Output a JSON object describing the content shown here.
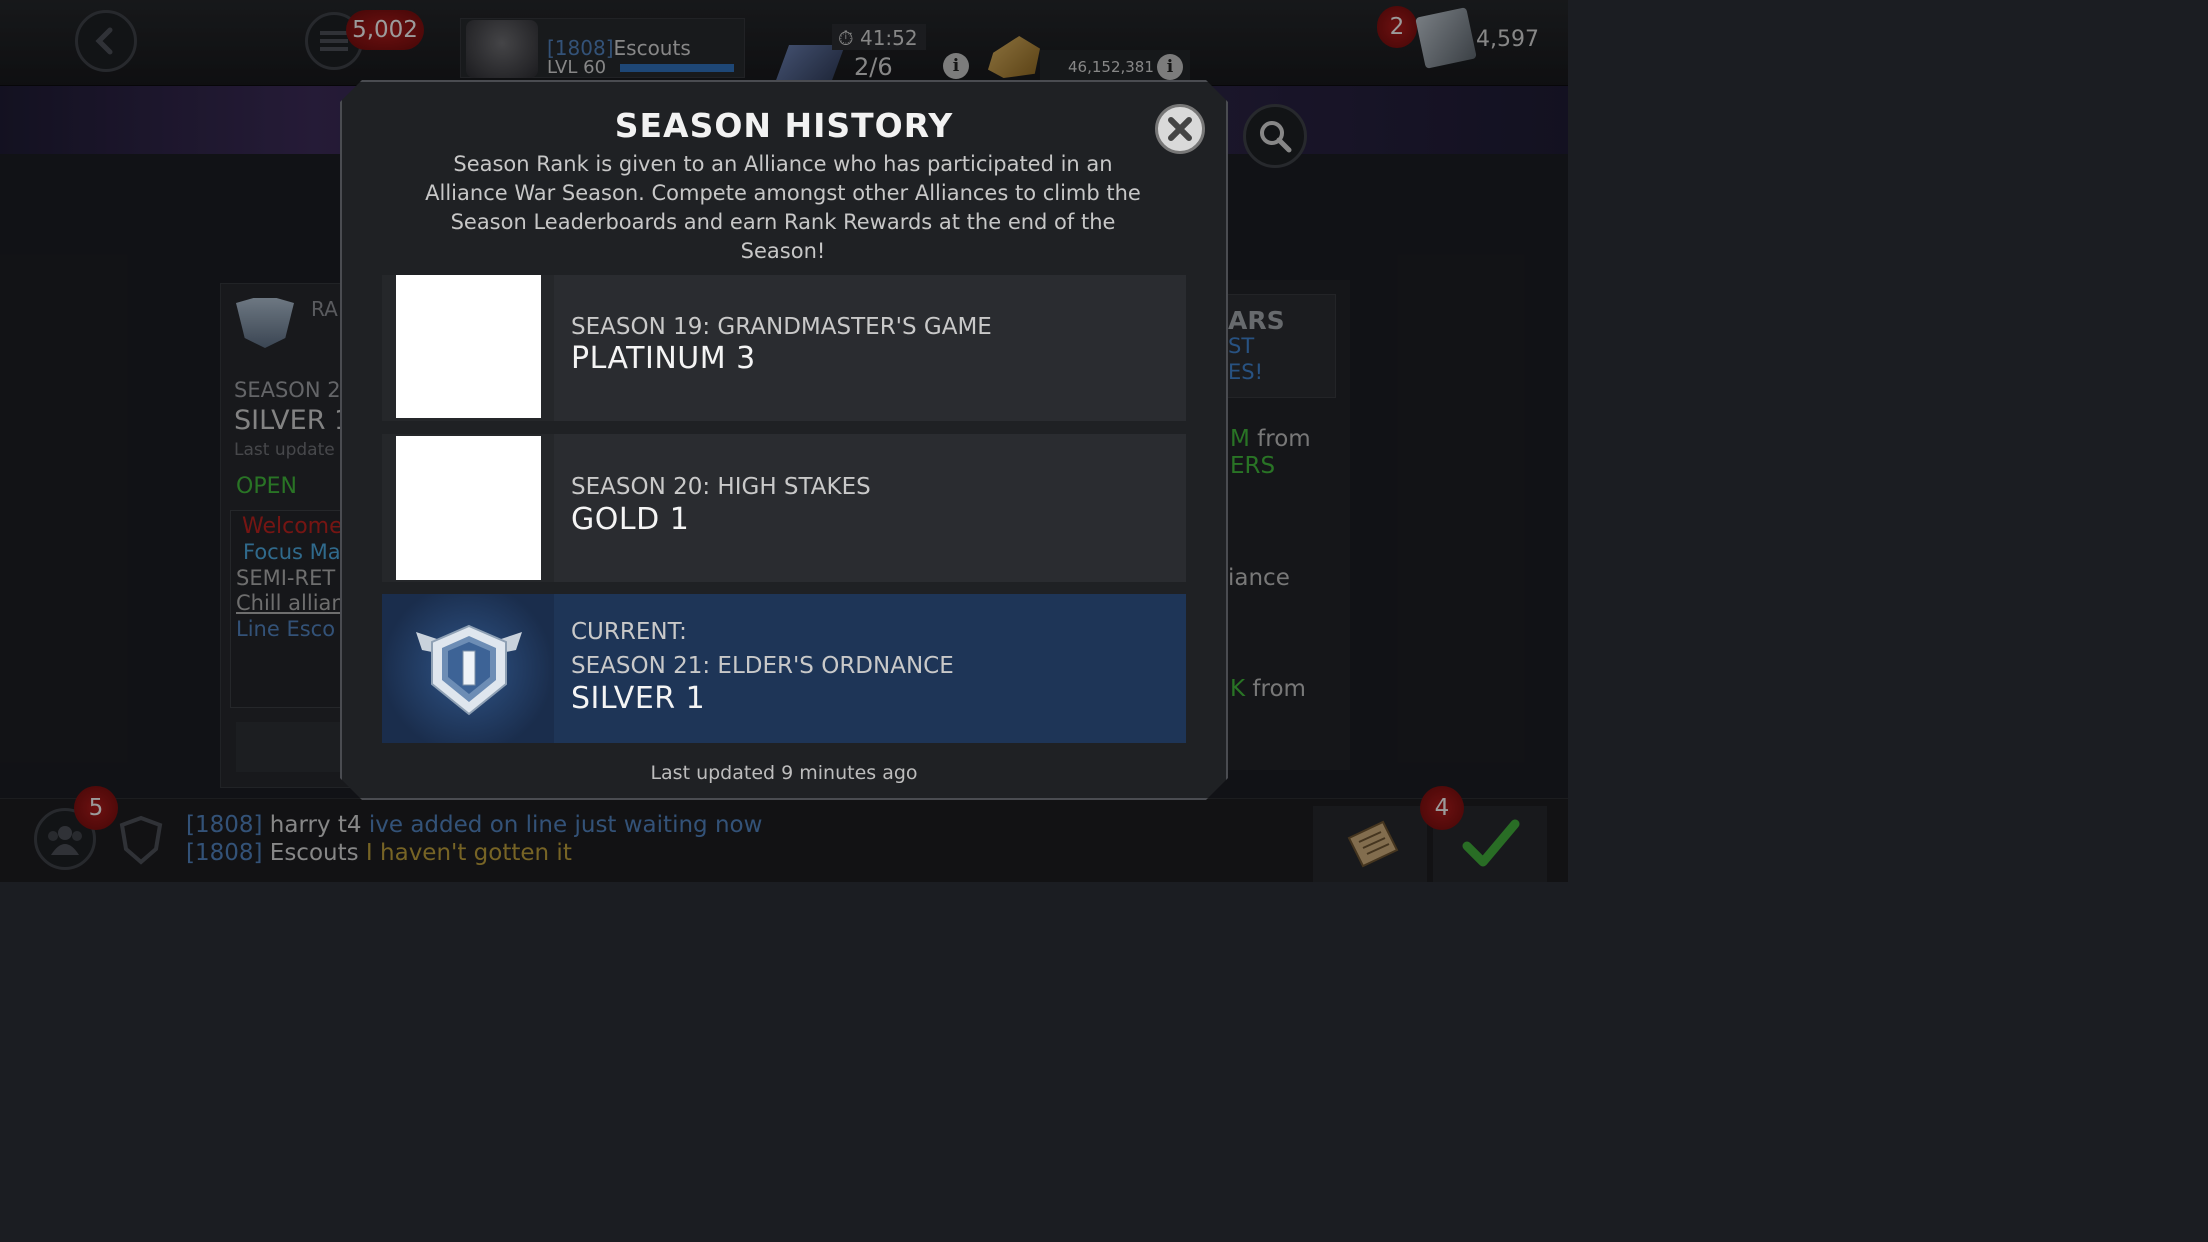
{
  "topbar": {
    "units_count": "5,002",
    "player_tag": "[1808]",
    "player_name": "Escouts",
    "player_level": "LVL 60",
    "timer": "41:52",
    "war_progress": "2/6",
    "gold_amount": "46,152,381",
    "notification_count": "2",
    "battlechips_count": "4,597"
  },
  "background": {
    "left_panel": {
      "header": "RA",
      "season": "SEASON 2",
      "rank": "SILVER 1",
      "updated": "Last update",
      "status": "OPEN",
      "messages": [
        "Welcome",
        "Focus Ma",
        "SEMI-RET",
        "Chill allian",
        "Line  Esco"
      ]
    },
    "right_panel": {
      "lines": [
        "ARS",
        "ST",
        "ES!",
        "M from",
        "ERS",
        "iance",
        "K from"
      ]
    }
  },
  "modal": {
    "title": "SEASON HISTORY",
    "description": "Season Rank is given to an Alliance who has participated in an Alliance War Season. Compete amongst other Alliances to climb the Season Leaderboards and earn Rank Rewards at the end of the Season!",
    "seasons": [
      {
        "name": "SEASON 19: GRANDMASTER'S GAME",
        "rank": "PLATINUM 3"
      },
      {
        "name": "SEASON 20: HIGH STAKES",
        "rank": "GOLD 1"
      }
    ],
    "current": {
      "label": "CURRENT:",
      "name": "SEASON 21: ELDER'S ORDNANCE",
      "rank": "SILVER 1",
      "badge_numeral": "I"
    },
    "last_updated": "Last updated 9 minutes ago"
  },
  "bottombar": {
    "alliance_badge_count": "5",
    "quests_badge_count": "4",
    "chat": [
      {
        "tag": "[1808]",
        "name": "harry t4",
        "message": "ive added on line just waiting now",
        "color": "#4f7fb8"
      },
      {
        "tag": "[1808]",
        "name": "Escouts",
        "message": "I haven't gotten it",
        "color": "#b79a3a"
      }
    ]
  },
  "colors": {
    "current_row": "#1e3557",
    "accent_red": "#a81a1a",
    "open_green": "#3fb23a"
  }
}
